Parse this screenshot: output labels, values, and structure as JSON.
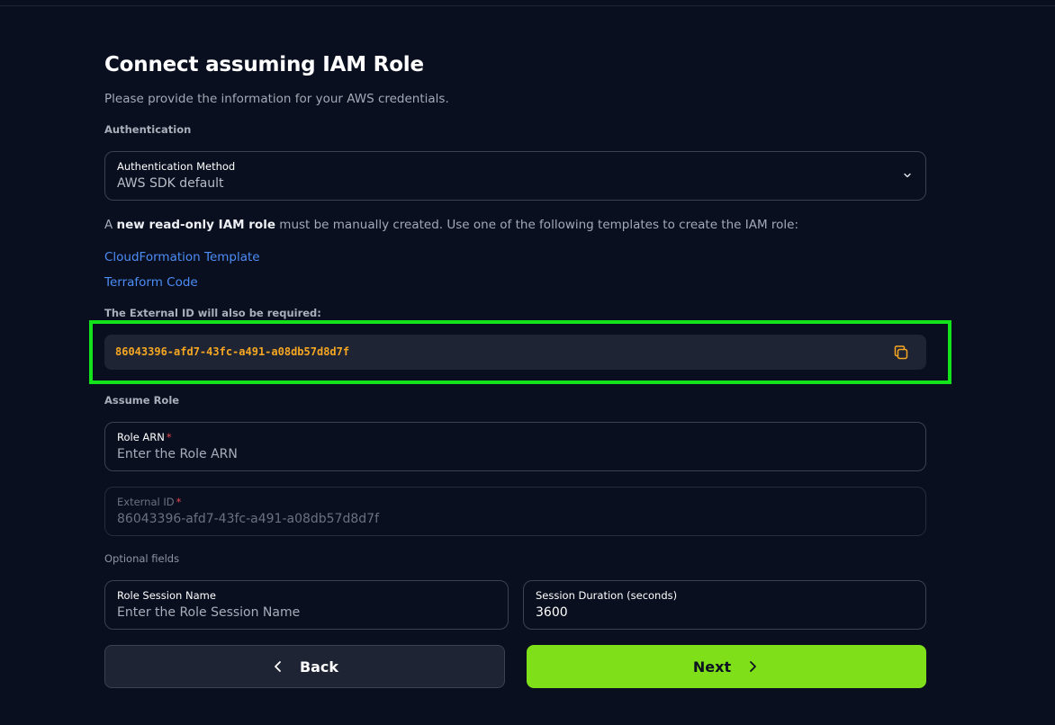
{
  "header": {
    "title": "Connect assuming IAM Role",
    "subtitle": "Please provide the information for your AWS credentials."
  },
  "authentication": {
    "section_label": "Authentication",
    "method_label": "Authentication Method",
    "method_value": "AWS SDK default"
  },
  "info": {
    "prefix": "A ",
    "bold": "new read-only IAM role",
    "suffix": " must be manually created. Use one of the following templates to create the IAM role:"
  },
  "links": {
    "cloudformation": "CloudFormation Template",
    "terraform": "Terraform Code"
  },
  "external_id": {
    "note": "The External ID will also be required:",
    "value": "86043396-afd7-43fc-a491-a08db57d8d7f"
  },
  "assume_role": {
    "section_label": "Assume Role",
    "role_arn_label": "Role ARN",
    "role_arn_placeholder": "Enter the Role ARN",
    "external_id_label": "External ID",
    "external_id_value": "86043396-afd7-43fc-a491-a08db57d8d7f",
    "required_mark": "*"
  },
  "optional": {
    "section_label": "Optional fields",
    "session_name_label": "Role Session Name",
    "session_name_placeholder": "Enter the Role Session Name",
    "duration_label": "Session Duration (seconds)",
    "duration_value": "3600"
  },
  "buttons": {
    "back": "Back",
    "next": "Next"
  },
  "colors": {
    "background": "#090f1f",
    "accent_green": "#7fe01a",
    "link_blue": "#4c8df6",
    "external_id_orange": "#f5a623",
    "highlight": "#12e31b"
  }
}
